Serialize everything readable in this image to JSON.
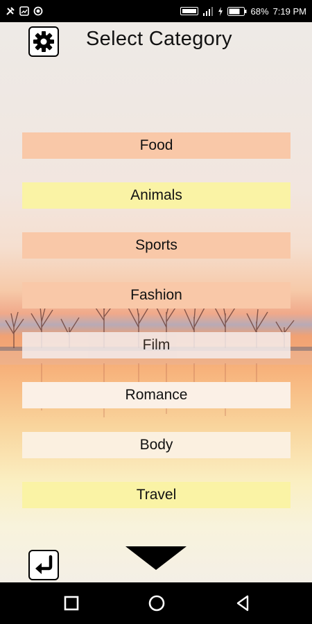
{
  "status_bar": {
    "battery": "68%",
    "time": "7:19 PM",
    "left_icons": [
      "tools-icon",
      "image-icon",
      "record-icon"
    ],
    "right_icons": [
      "volte-icon",
      "signal-icon",
      "charging-icon",
      "battery-icon"
    ]
  },
  "header": {
    "title": "Select Category",
    "settings_icon": "gear-icon"
  },
  "categories": [
    {
      "label": "Food",
      "color": "#f9c8a8"
    },
    {
      "label": "Animals",
      "color": "#faf3a5"
    },
    {
      "label": "Sports",
      "color": "#f9c8a8"
    },
    {
      "label": "Fashion",
      "color": "#f9c8a8"
    },
    {
      "label": "Film",
      "color": "#f3ecec"
    },
    {
      "label": "Romance",
      "color": "#fbf0e6"
    },
    {
      "label": "Body",
      "color": "#fbf0e0"
    },
    {
      "label": "Travel",
      "color": "#faf3a5"
    }
  ],
  "footer": {
    "back_icon": "back-arrow-icon",
    "down_icon": "down-triangle-icon"
  },
  "nav_bar": {
    "icons": [
      "square-recents-icon",
      "circle-home-icon",
      "triangle-back-icon"
    ]
  }
}
